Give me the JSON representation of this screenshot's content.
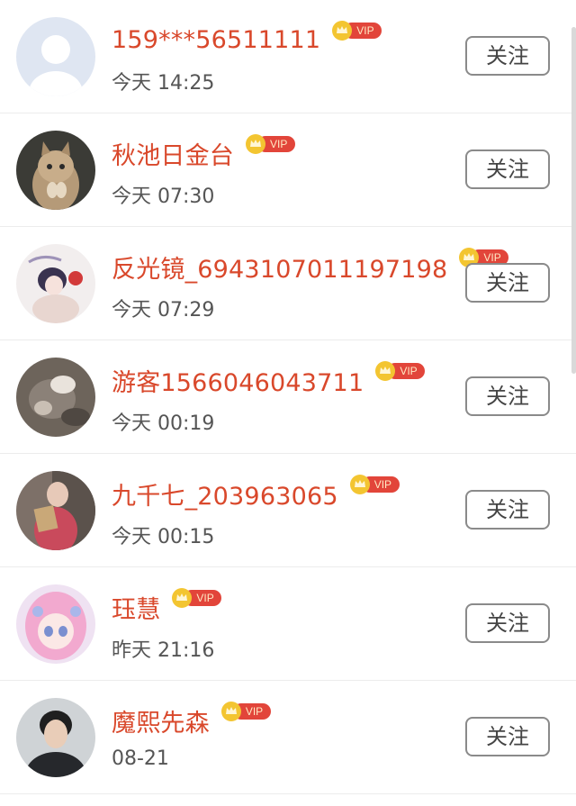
{
  "follow_label": "关注",
  "vip_label": "VIP",
  "users": [
    {
      "name": "159***56511111",
      "time": "今天 14:25",
      "avatar": "default-avatar"
    },
    {
      "name": "秋池日金台",
      "time": "今天 07:30",
      "avatar": "kitten-avatar"
    },
    {
      "name": "反光镜_6943107011197198",
      "time": "今天 07:29",
      "avatar": "anime-girl-avatar"
    },
    {
      "name": "游客1566046043711",
      "time": "今天 00:19",
      "avatar": "cat-photo-avatar"
    },
    {
      "name": "九千七_203963065",
      "time": "今天 00:15",
      "avatar": "girl-photo-avatar"
    },
    {
      "name": "珏慧",
      "time": "昨天 21:16",
      "avatar": "pink-anime-avatar"
    },
    {
      "name": "魔熙先森",
      "time": "08-21",
      "avatar": "man-photo-avatar"
    }
  ],
  "colors": {
    "name": "#d9482b",
    "vip_badge": "#e2453a",
    "crown": "#f3c531",
    "time": "#555555",
    "button_border": "#8a8a8a"
  }
}
